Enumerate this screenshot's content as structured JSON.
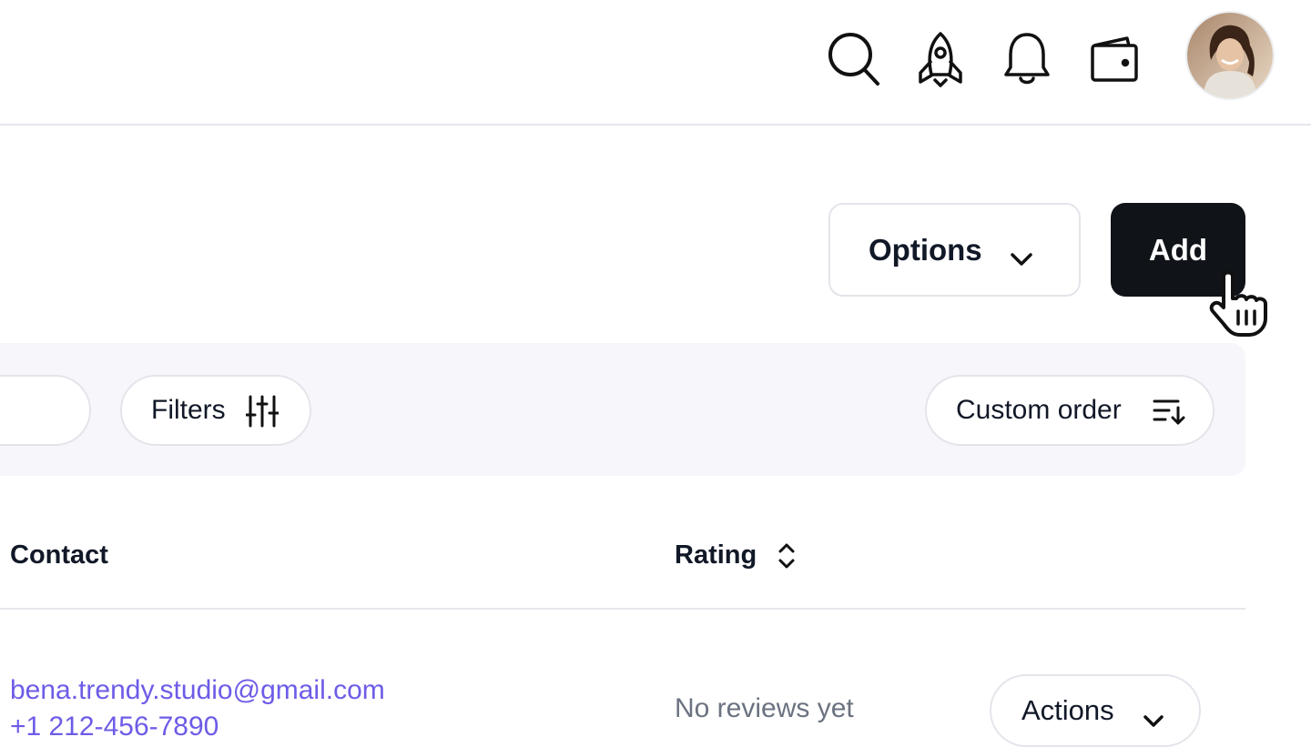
{
  "topbar": {
    "icons": [
      "search-icon",
      "rocket-icon",
      "bell-icon",
      "wallet-icon"
    ],
    "avatar_alt": "user-avatar"
  },
  "toolbar": {
    "options_label": "Options",
    "add_label": "Add"
  },
  "filterbar": {
    "filters_label": "Filters",
    "order_label": "Custom order"
  },
  "table": {
    "columns": [
      "Contact",
      "Rating"
    ],
    "rows": [
      {
        "email": "bena.trendy.studio@gmail.com",
        "phone": "+1 212-456-7890",
        "rating": "No reviews yet",
        "actions_label": "Actions"
      }
    ]
  },
  "colors": {
    "primary": "#101418",
    "link": "#6d5ce7",
    "muted": "#6b7280",
    "filterbar_bg": "#f6f6fb"
  }
}
